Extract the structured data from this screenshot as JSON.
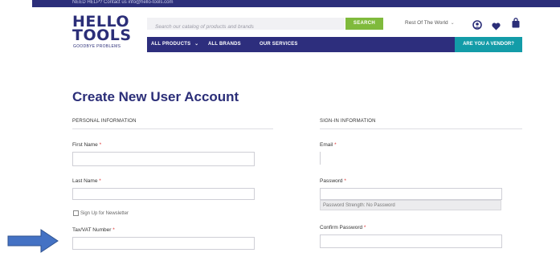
{
  "topbar": {
    "text": "NEED HELP? Contact us info@hello-tools.com"
  },
  "logo": {
    "line1": "HELLO",
    "line2": "TOOLS",
    "tagline": "GOODBYE PROBLEMS"
  },
  "search": {
    "placeholder": "Search our catalog of products and brands",
    "button_label": "SEARCH"
  },
  "region": {
    "label": "Rest Of The World",
    "chevron": "⌄"
  },
  "icons": {
    "account": "user-icon",
    "wishlist": "heart-icon",
    "cart": "bag-icon"
  },
  "nav": {
    "all_products": "ALL PRODUCTS",
    "chevron": "⌄",
    "all_brands": "ALL BRANDS",
    "services": "OUR SERVICES",
    "vendor": "ARE YOU A VENDOR?"
  },
  "page": {
    "title": "Create New User Account"
  },
  "personal": {
    "heading": "PERSONAL INFORMATION",
    "first_name": "First Name",
    "last_name": "Last Name",
    "newsletter": "Sign Up for Newsletter",
    "tax": "Tax/VAT Number"
  },
  "signin": {
    "heading": "SIGN-IN INFORMATION",
    "email": "Email",
    "password": "Password",
    "strength": "Password Strength: No Password",
    "confirm": "Confirm Password"
  },
  "required_mark": "*",
  "colors": {
    "navy": "#2b2e78",
    "nav_bg": "#2d2e7d",
    "green": "#7fba3c",
    "teal": "#139ca8",
    "arrow": "#4472c4"
  }
}
